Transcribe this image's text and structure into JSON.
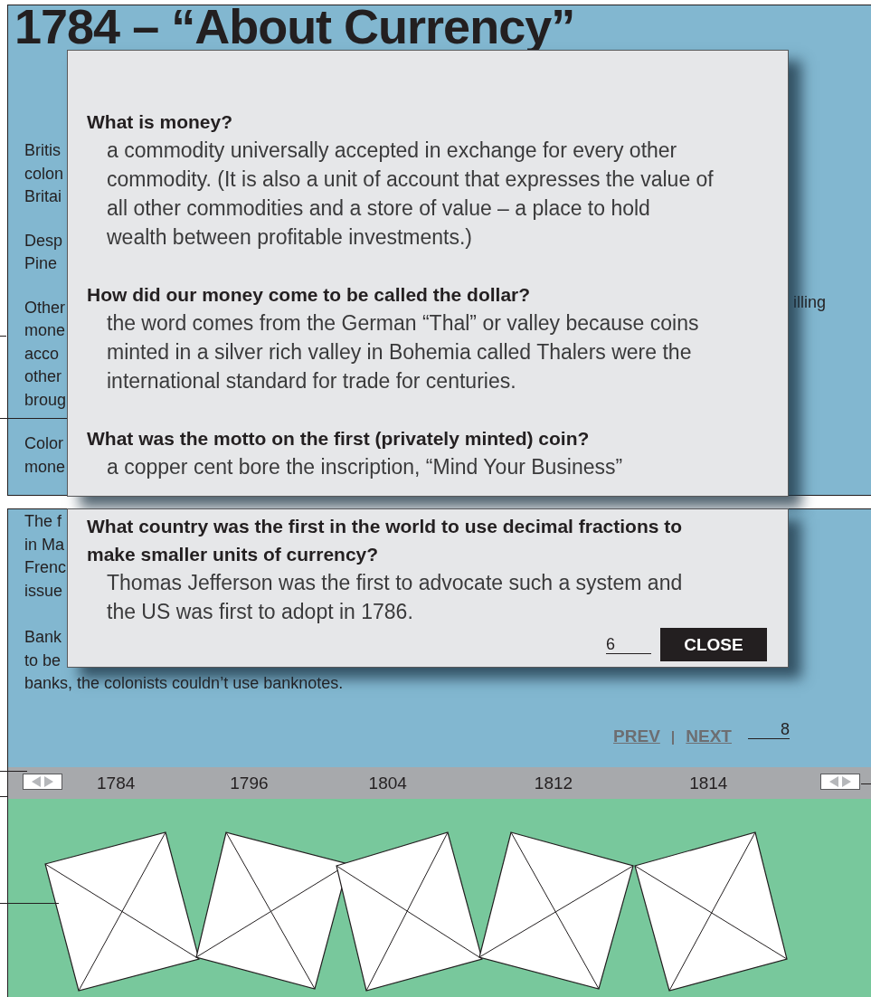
{
  "title": "1784 – “About Currency”",
  "upper_paragraphs": [
    [
      "Britis",
      "colon",
      "Britai"
    ],
    [
      "Desp",
      "Pine"
    ],
    [
      "Other",
      "mone",
      "acco",
      "other",
      "broug"
    ],
    [
      "Color",
      "mone"
    ]
  ],
  "right_fragment": "illing",
  "lower_paragraphs": [
    [
      "The f",
      "in Ma",
      "Frenc",
      "issue"
    ],
    [
      "Bank",
      "to be",
      "banks, the colonists couldn’t use banknotes."
    ]
  ],
  "dialog": {
    "top_items": [
      {
        "question": "What is money?",
        "answer": "a commodity universally accepted in exchange for every other commodity. (It is also a unit of account that expresses the value of all other commodities and a store of value – a place to hold wealth between profitable investments.)"
      },
      {
        "question": "How did our money come to be called the dollar?",
        "answer": "the word comes from the German “Thal” or valley because coins minted in a silver rich valley in Bohemia called Thalers were the international standard for trade for centuries."
      },
      {
        "question": "What was the motto on the first (privately minted) coin?",
        "answer": "a copper cent bore the inscription, “Mind Your Business”"
      }
    ],
    "bottom_items": [
      {
        "question": "What country was the first in the world to use decimal fractions to make smaller units of currency?",
        "answer": "Thomas Jefferson was the first to advocate such a system and the US was first to adopt in 1786."
      }
    ],
    "page_marker": "6",
    "close_button": "CLOSE"
  },
  "pager": {
    "prev": "PREV",
    "separator": "|",
    "next": "NEXT",
    "marker": "8"
  },
  "timeline": {
    "years": [
      "1784",
      "1796",
      "1804",
      "1812",
      "1814"
    ]
  },
  "images": [
    {
      "kind": "picture"
    },
    {
      "kind": "picture"
    },
    {
      "kind": "picture"
    },
    {
      "kind": "picture"
    },
    {
      "kind": "picture"
    }
  ]
}
